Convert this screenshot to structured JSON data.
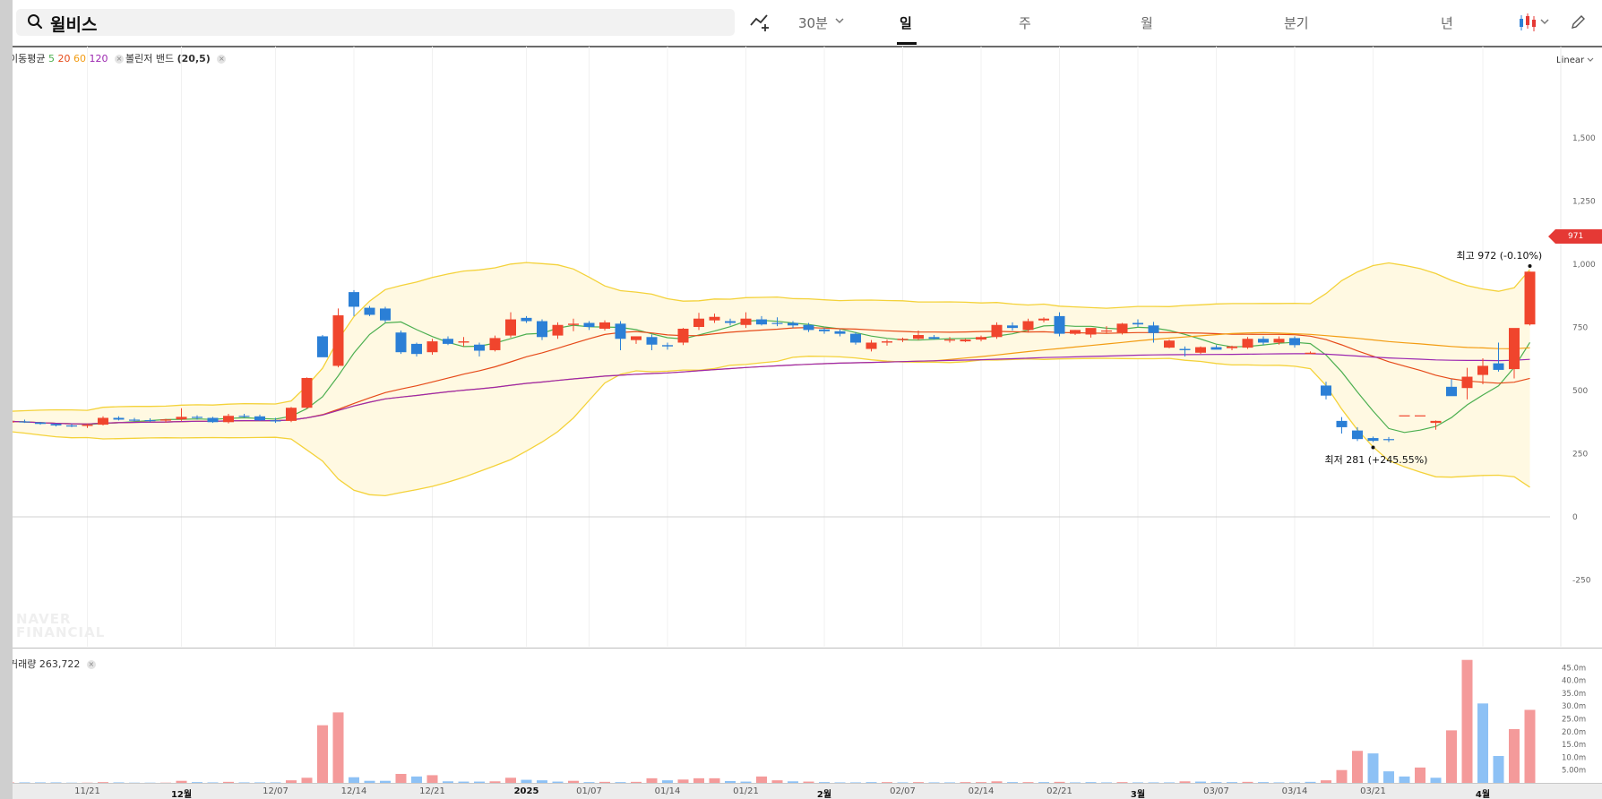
{
  "search": {
    "query": "윌비스"
  },
  "periods": [
    "30분",
    "일",
    "주",
    "월",
    "분기",
    "년"
  ],
  "selected_period": "일",
  "indicators": {
    "ma_label": "이동평균",
    "ma_values": [
      "5",
      "20",
      "60",
      "120"
    ],
    "ma_colors": [
      "#4caf50",
      "#e64a19",
      "#f39c12",
      "#9c27b0"
    ],
    "bb_label": "볼린저 밴드",
    "bb_params": "(20,5)"
  },
  "scale_mode": "Linear",
  "volume_legend": {
    "label": "거래량",
    "value": "263,722"
  },
  "watermark": [
    "NAVER",
    "FINANCIAL"
  ],
  "colors": {
    "up": "#f0452d",
    "down": "#2b7fd6",
    "vol_up": "#f49a9a",
    "vol_down": "#8dc1f5",
    "band_line": "#f4d23a",
    "band_fill": "#fff9e2"
  },
  "annotations": {
    "high": "최고 972 (-0.10%)",
    "low": "최저 281 (+245.55%)",
    "current_price": "971"
  },
  "chart_data": {
    "type": "candlestick",
    "title": "",
    "yaxis": {
      "ticks": [
        1500,
        1250,
        1000,
        750,
        500,
        250,
        0,
        -250
      ],
      "ylim": [
        -450,
        1585
      ]
    },
    "volume_axis": {
      "ticks": [
        "45.0m",
        "40.0m",
        "35.0m",
        "30.0m",
        "25.0m",
        "20.0m",
        "15.0m",
        "10.0m",
        "5.00m"
      ],
      "ylim_m": [
        0,
        48
      ]
    },
    "xaxis": {
      "ticks": [
        "11/21",
        "12월",
        "12/07",
        "12/14",
        "12/21",
        "2025",
        "01/07",
        "01/14",
        "01/21",
        "2월",
        "02/07",
        "02/14",
        "02/21",
        "3월",
        "03/07",
        "03/14",
        "03/21",
        "4월"
      ],
      "tick_indices": [
        5,
        11,
        17,
        22,
        27,
        33,
        37,
        42,
        47,
        52,
        57,
        62,
        67,
        72,
        77,
        82,
        87,
        94
      ],
      "major": [
        "12월",
        "2025",
        "2월",
        "3월",
        "4월"
      ]
    },
    "candles": [
      [
        375,
        380,
        370,
        378
      ],
      [
        378,
        385,
        372,
        374
      ],
      [
        374,
        376,
        365,
        368
      ],
      [
        368,
        370,
        358,
        362
      ],
      [
        362,
        368,
        355,
        360
      ],
      [
        360,
        368,
        352,
        365
      ],
      [
        365,
        398,
        362,
        392
      ],
      [
        392,
        398,
        382,
        385
      ],
      [
        385,
        392,
        378,
        383
      ],
      [
        383,
        390,
        376,
        381
      ],
      [
        381,
        388,
        374,
        386
      ],
      [
        386,
        430,
        380,
        396
      ],
      [
        396,
        402,
        385,
        392
      ],
      [
        392,
        396,
        372,
        375
      ],
      [
        375,
        408,
        370,
        400
      ],
      [
        400,
        408,
        392,
        398
      ],
      [
        398,
        405,
        380,
        382
      ],
      [
        382,
        392,
        372,
        380
      ],
      [
        380,
        435,
        375,
        432
      ],
      [
        432,
        552,
        428,
        550
      ],
      [
        715,
        720,
        635,
        632
      ],
      [
        598,
        825,
        592,
        798
      ],
      [
        890,
        898,
        795,
        832
      ],
      [
        828,
        835,
        795,
        800
      ],
      [
        825,
        832,
        770,
        778
      ],
      [
        730,
        738,
        645,
        652
      ],
      [
        685,
        690,
        635,
        645
      ],
      [
        652,
        705,
        642,
        695
      ],
      [
        705,
        715,
        680,
        685
      ],
      [
        690,
        712,
        675,
        695
      ],
      [
        682,
        690,
        635,
        658
      ],
      [
        660,
        718,
        655,
        708
      ],
      [
        718,
        810,
        710,
        782
      ],
      [
        788,
        795,
        768,
        775
      ],
      [
        775,
        782,
        700,
        712
      ],
      [
        718,
        770,
        705,
        760
      ],
      [
        760,
        785,
        735,
        765
      ],
      [
        768,
        775,
        740,
        752
      ],
      [
        745,
        778,
        738,
        770
      ],
      [
        765,
        775,
        660,
        705
      ],
      [
        700,
        715,
        685,
        715
      ],
      [
        712,
        722,
        660,
        682
      ],
      [
        680,
        690,
        662,
        675
      ],
      [
        690,
        748,
        680,
        745
      ],
      [
        752,
        808,
        740,
        785
      ],
      [
        778,
        805,
        768,
        792
      ],
      [
        775,
        785,
        758,
        768
      ],
      [
        760,
        810,
        748,
        785
      ],
      [
        782,
        795,
        758,
        762
      ],
      [
        768,
        790,
        755,
        765
      ],
      [
        768,
        775,
        748,
        758
      ],
      [
        760,
        768,
        732,
        740
      ],
      [
        742,
        748,
        725,
        735
      ],
      [
        735,
        742,
        715,
        725
      ],
      [
        725,
        732,
        682,
        690
      ],
      [
        665,
        700,
        655,
        690
      ],
      [
        690,
        702,
        678,
        695
      ],
      [
        700,
        710,
        692,
        705
      ],
      [
        705,
        738,
        700,
        720
      ],
      [
        712,
        720,
        702,
        705
      ],
      [
        702,
        712,
        690,
        702
      ],
      [
        695,
        705,
        692,
        702
      ],
      [
        702,
        718,
        695,
        712
      ],
      [
        712,
        770,
        705,
        760
      ],
      [
        758,
        770,
        738,
        748
      ],
      [
        740,
        785,
        730,
        775
      ],
      [
        778,
        790,
        770,
        785
      ],
      [
        795,
        810,
        715,
        725
      ],
      [
        725,
        740,
        720,
        740
      ],
      [
        722,
        738,
        710,
        748
      ],
      [
        735,
        755,
        728,
        738
      ],
      [
        730,
        768,
        722,
        765
      ],
      [
        768,
        782,
        752,
        762
      ],
      [
        758,
        772,
        690,
        728
      ],
      [
        670,
        702,
        668,
        698
      ],
      [
        665,
        675,
        635,
        660
      ],
      [
        650,
        675,
        645,
        672
      ],
      [
        672,
        680,
        665,
        662
      ],
      [
        668,
        678,
        660,
        675
      ],
      [
        670,
        712,
        665,
        705
      ],
      [
        705,
        715,
        680,
        690
      ],
      [
        690,
        715,
        682,
        705
      ],
      [
        708,
        715,
        670,
        680
      ],
      [
        645,
        655,
        645,
        650
      ],
      [
        520,
        535,
        465,
        480
      ],
      [
        380,
        395,
        330,
        355
      ],
      [
        342,
        355,
        300,
        308
      ],
      [
        312,
        318,
        296,
        301
      ],
      [
        308,
        316,
        296,
        304
      ],
      [
        402,
        402,
        402,
        402
      ],
      [
        402,
        402,
        402,
        402
      ],
      [
        372,
        382,
        345,
        380
      ],
      [
        515,
        545,
        490,
        478
      ],
      [
        510,
        590,
        465,
        555
      ],
      [
        562,
        628,
        525,
        598
      ],
      [
        608,
        690,
        575,
        582
      ],
      [
        585,
        650,
        548,
        748
      ],
      [
        762,
        972,
        758,
        971
      ]
    ],
    "volume_m": [
      [
        0.2,
        1
      ],
      [
        0.2,
        0
      ],
      [
        0.2,
        0
      ],
      [
        0.2,
        0
      ],
      [
        0.1,
        0
      ],
      [
        0.1,
        1
      ],
      [
        0.3,
        1
      ],
      [
        0.2,
        0
      ],
      [
        0.1,
        0
      ],
      [
        0.1,
        0
      ],
      [
        0.1,
        1
      ],
      [
        0.8,
        1
      ],
      [
        0.3,
        0
      ],
      [
        0.2,
        0
      ],
      [
        0.4,
        1
      ],
      [
        0.2,
        0
      ],
      [
        0.2,
        0
      ],
      [
        0.2,
        0
      ],
      [
        1.0,
        1
      ],
      [
        2.0,
        1
      ],
      [
        22.5,
        1
      ],
      [
        27.5,
        1
      ],
      [
        2.2,
        0
      ],
      [
        0.8,
        0
      ],
      [
        0.8,
        0
      ],
      [
        3.5,
        1
      ],
      [
        2.5,
        0
      ],
      [
        3.0,
        1
      ],
      [
        0.6,
        0
      ],
      [
        0.5,
        0
      ],
      [
        0.5,
        0
      ],
      [
        0.6,
        1
      ],
      [
        2.0,
        1
      ],
      [
        1.2,
        0
      ],
      [
        1.0,
        0
      ],
      [
        0.5,
        0
      ],
      [
        0.8,
        1
      ],
      [
        0.3,
        0
      ],
      [
        0.4,
        1
      ],
      [
        0.3,
        0
      ],
      [
        0.4,
        1
      ],
      [
        1.8,
        1
      ],
      [
        1.0,
        0
      ],
      [
        1.3,
        1
      ],
      [
        1.8,
        1
      ],
      [
        1.8,
        1
      ],
      [
        0.7,
        0
      ],
      [
        0.5,
        0
      ],
      [
        2.5,
        1
      ],
      [
        1.0,
        1
      ],
      [
        0.6,
        0
      ],
      [
        0.5,
        1
      ],
      [
        0.3,
        0
      ],
      [
        0.2,
        0
      ],
      [
        0.2,
        0
      ],
      [
        0.3,
        0
      ],
      [
        0.3,
        1
      ],
      [
        0.2,
        0
      ],
      [
        0.3,
        1
      ],
      [
        0.2,
        0
      ],
      [
        0.2,
        0
      ],
      [
        0.3,
        1
      ],
      [
        0.3,
        1
      ],
      [
        0.6,
        1
      ],
      [
        0.3,
        0
      ],
      [
        0.3,
        1
      ],
      [
        0.3,
        0
      ],
      [
        0.4,
        1
      ],
      [
        0.2,
        0
      ],
      [
        0.3,
        0
      ],
      [
        0.2,
        0
      ],
      [
        0.3,
        1
      ],
      [
        0.2,
        0
      ],
      [
        0.2,
        0
      ],
      [
        0.2,
        0
      ],
      [
        0.6,
        1
      ],
      [
        0.5,
        0
      ],
      [
        0.3,
        0
      ],
      [
        0.3,
        0
      ],
      [
        0.4,
        1
      ],
      [
        0.3,
        0
      ],
      [
        0.2,
        0
      ],
      [
        0.2,
        0
      ],
      [
        0.4,
        0
      ],
      [
        1.0,
        1
      ],
      [
        5.0,
        1
      ],
      [
        12.5,
        1
      ],
      [
        11.5,
        0
      ],
      [
        4.5,
        0
      ],
      [
        2.5,
        0
      ],
      [
        6.0,
        1
      ],
      [
        2.0,
        0
      ],
      [
        20.5,
        1
      ],
      [
        48.0,
        1
      ],
      [
        31.0,
        0
      ],
      [
        10.5,
        0
      ],
      [
        21.0,
        1
      ],
      [
        28.5,
        1
      ]
    ],
    "series": [
      {
        "name": "5"
      },
      {
        "name": "20"
      },
      {
        "name": "60"
      },
      {
        "name": "120"
      }
    ]
  }
}
